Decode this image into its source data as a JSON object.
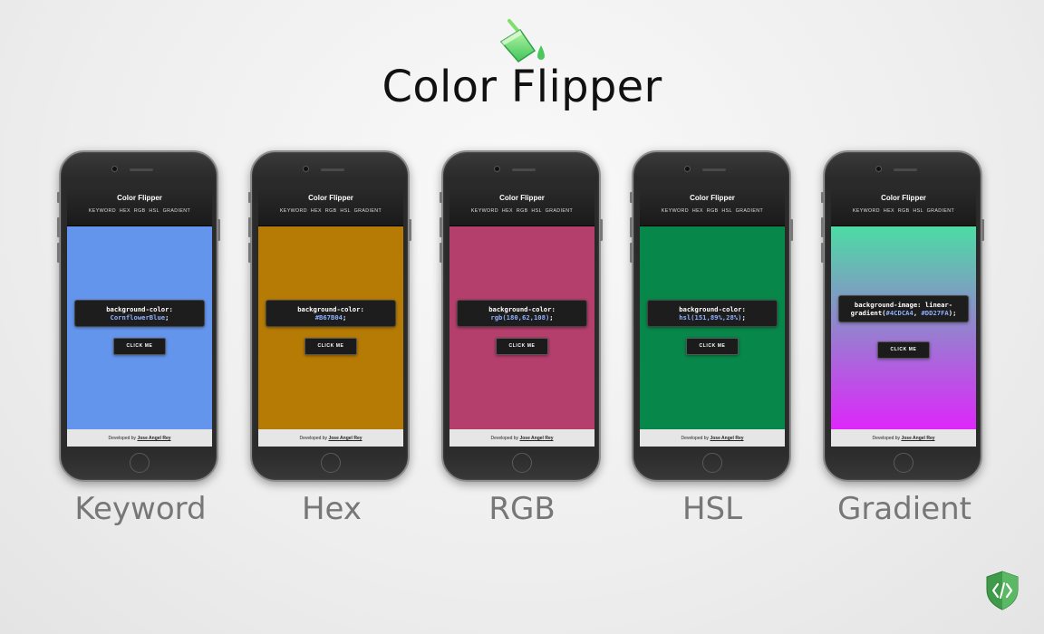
{
  "page": {
    "title": "Color Flipper",
    "icons": {
      "logo": "paint-bucket-icon",
      "badge": "code-shield-icon"
    }
  },
  "app": {
    "title": "Color Flipper",
    "nav": [
      "KEYWORD",
      "HEX",
      "RGB",
      "HSL",
      "GRADIENT"
    ],
    "button_label": "CLICK ME",
    "footer_prefix": "Developed by",
    "footer_author": "Jose Angel Rey"
  },
  "phones": [
    {
      "caption": "Keyword",
      "background": "#6495ED",
      "code_prop": "background-color:",
      "code_value": "CornflowerBlue",
      "code_suffix": ";"
    },
    {
      "caption": "Hex",
      "background": "#B67B04",
      "code_prop": "background-color:",
      "code_value": "#B67B04",
      "code_suffix": ";"
    },
    {
      "caption": "RGB",
      "background": "#B43E6C",
      "code_prop": "background-color:",
      "code_value": "rgb(180,62,108)",
      "code_suffix": ";"
    },
    {
      "caption": "HSL",
      "background": "#08874A",
      "code_prop": "background-color:",
      "code_value": "hsl(151,89%,28%)",
      "code_suffix": ";"
    },
    {
      "caption": "Gradient",
      "background": "linear-gradient(#4CDCA4, #DD27FA)",
      "code_prop": "background-image: linear-gradient(",
      "code_value": "#4CDCA4",
      "code_mid": ", ",
      "code_value2": "#DD27FA",
      "code_suffix": ");"
    }
  ]
}
